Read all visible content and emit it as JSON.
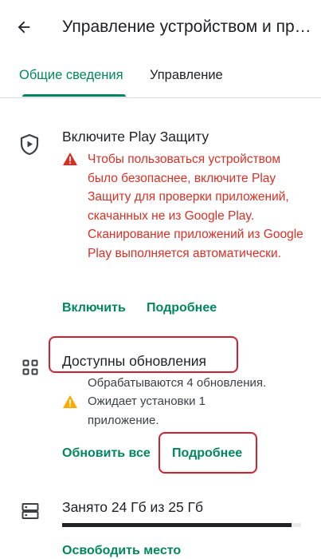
{
  "header": {
    "title": "Управление устройством и приложениями"
  },
  "tabs": [
    {
      "label": "Общие сведения",
      "active": true
    },
    {
      "label": "Управление",
      "active": false
    }
  ],
  "protect": {
    "title": "Включите Play Защиту",
    "warning": "Чтобы пользоваться устройством было безопаснее, включите Play Защиту для проверки приложений, скачанных не из Google Play. Сканирование приложений из Google Play выполняется автоматически.",
    "enable_label": "Включить",
    "more_label": "Подробнее"
  },
  "updates": {
    "title": "Доступны обновления",
    "processing": "Обрабатываются 4 обновления.",
    "pending": "Ожидает установки 1 приложение.",
    "update_all_label": "Обновить все",
    "more_label": "Подробнее"
  },
  "storage": {
    "title": "Занято 24 Гб из 25 Гб",
    "used_fraction": 0.96,
    "free_label": "Освободить место"
  },
  "colors": {
    "accent": "#01875f",
    "warning": "#d93025",
    "highlight": "#d02131",
    "warning_icon": "#f9ab00"
  }
}
